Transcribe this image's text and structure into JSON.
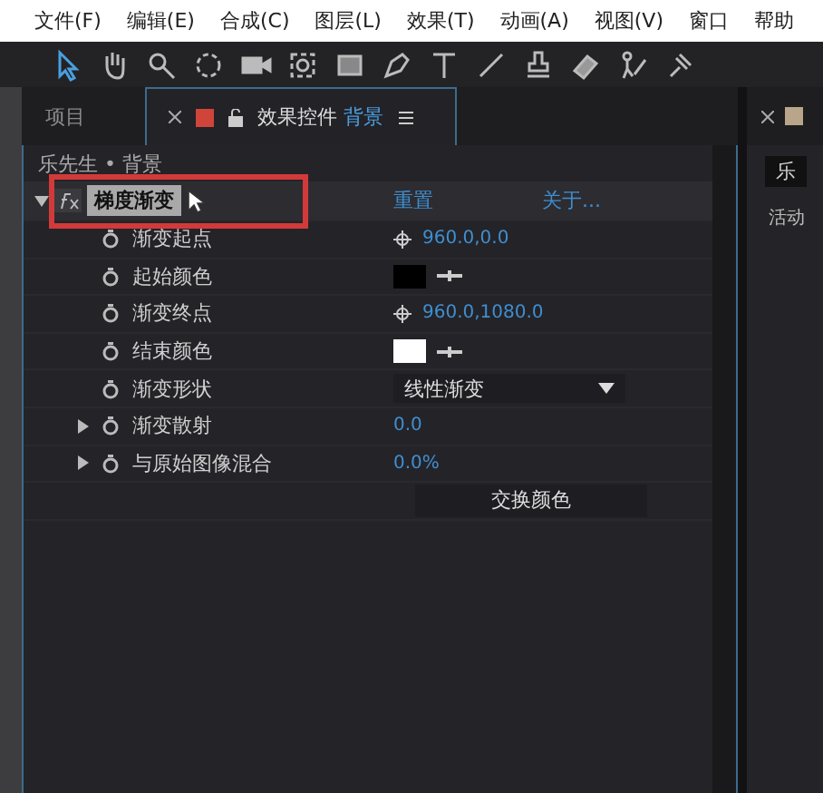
{
  "menu": [
    "文件(F)",
    "编辑(E)",
    "合成(C)",
    "图层(L)",
    "效果(T)",
    "动画(A)",
    "视图(V)",
    "窗口",
    "帮助"
  ],
  "tabs": [
    {
      "label": "项目",
      "selected": false
    },
    {
      "label": "效果控件",
      "layer": "背景",
      "selected": true
    }
  ],
  "breadcrumb": "乐先生 • 背景",
  "effect": {
    "name": "梯度渐变",
    "expanded": true,
    "reset": "重置",
    "about": "关于..."
  },
  "params": [
    {
      "kind": "point",
      "name": "渐变起点",
      "value": "960.0,0.0"
    },
    {
      "kind": "color",
      "name": "起始颜色",
      "color": "#000000"
    },
    {
      "kind": "point",
      "name": "渐变终点",
      "value": "960.0,1080.0"
    },
    {
      "kind": "color",
      "name": "结束颜色",
      "color": "#ffffff"
    },
    {
      "kind": "dropdown",
      "name": "渐变形状",
      "value": "线性渐变"
    },
    {
      "kind": "number",
      "name": "渐变散射",
      "value": "0.0",
      "expanded": false
    },
    {
      "kind": "number",
      "name": "与原始图像混合",
      "value": "0.0%",
      "expanded": false
    },
    {
      "kind": "button",
      "label": "交换颜色"
    }
  ],
  "right_panel": {
    "tab": "乐",
    "label": "活动"
  }
}
